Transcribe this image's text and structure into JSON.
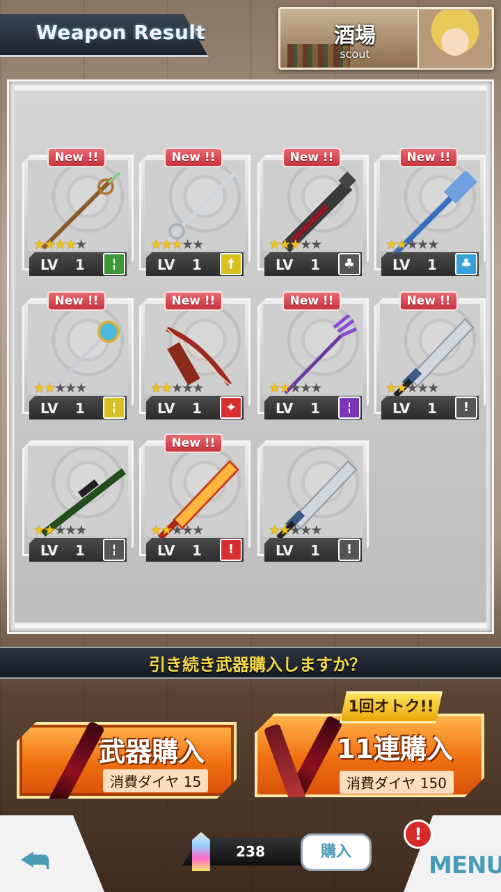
{
  "header": {
    "title": "Weapon Result",
    "location_name": "酒場",
    "location_sub": "scout"
  },
  "cards": [
    {
      "new": "New !!",
      "stars": 4,
      "lv_label": "LV",
      "lv": "1",
      "type_color": "#3a9a3a",
      "type_glyph": "¦",
      "weapon": "staff-brown"
    },
    {
      "new": "New !!",
      "stars": 3,
      "lv_label": "LV",
      "lv": "1",
      "type_color": "#d8c021",
      "type_glyph": "†",
      "weapon": "rapier"
    },
    {
      "new": "New !!",
      "stars": 3,
      "lv_label": "LV",
      "lv": "1",
      "type_color": "#555555",
      "type_glyph": "♣",
      "weapon": "club"
    },
    {
      "new": "New !!",
      "stars": 2,
      "lv_label": "LV",
      "lv": "1",
      "type_color": "#38a0d8",
      "type_glyph": "♣",
      "weapon": "mace-blue"
    },
    {
      "new": "New !!",
      "stars": 2,
      "lv_label": "LV",
      "lv": "1",
      "type_color": "#d8c021",
      "type_glyph": "¦",
      "weapon": "staff-gold"
    },
    {
      "new": "New !!",
      "stars": 2,
      "lv_label": "LV",
      "lv": "1",
      "type_color": "#d83030",
      "type_glyph": "⌖",
      "weapon": "bow"
    },
    {
      "new": "New !!",
      "stars": 2,
      "lv_label": "LV",
      "lv": "1",
      "type_color": "#7a35b8",
      "type_glyph": "¦",
      "weapon": "trident"
    },
    {
      "new": "New !!",
      "stars": 2,
      "lv_label": "LV",
      "lv": "1",
      "type_color": "#555555",
      "type_glyph": "!",
      "weapon": "sword"
    },
    {
      "new": "",
      "stars": 2,
      "lv_label": "LV",
      "lv": "1",
      "type_color": "#555555",
      "type_glyph": "¦",
      "weapon": "rifle"
    },
    {
      "new": "New !!",
      "stars": 2,
      "lv_label": "LV",
      "lv": "1",
      "type_color": "#d83030",
      "type_glyph": "!",
      "weapon": "fire-sword"
    },
    {
      "new": "",
      "stars": 2,
      "lv_label": "LV",
      "lv": "1",
      "type_color": "#555555",
      "type_glyph": "!",
      "weapon": "sword"
    }
  ],
  "prompt": "引き続き武器購入しますか？",
  "buy_single": {
    "label": "武器購入",
    "cost": "消費ダイヤ 15"
  },
  "buy_multi": {
    "label": "11連購入",
    "cost": "消費ダイヤ 150",
    "promo": "1回オトク!!"
  },
  "footer": {
    "diamonds": "238",
    "purchase_label": "購入",
    "menu_label": "MENU",
    "alert": "!"
  }
}
